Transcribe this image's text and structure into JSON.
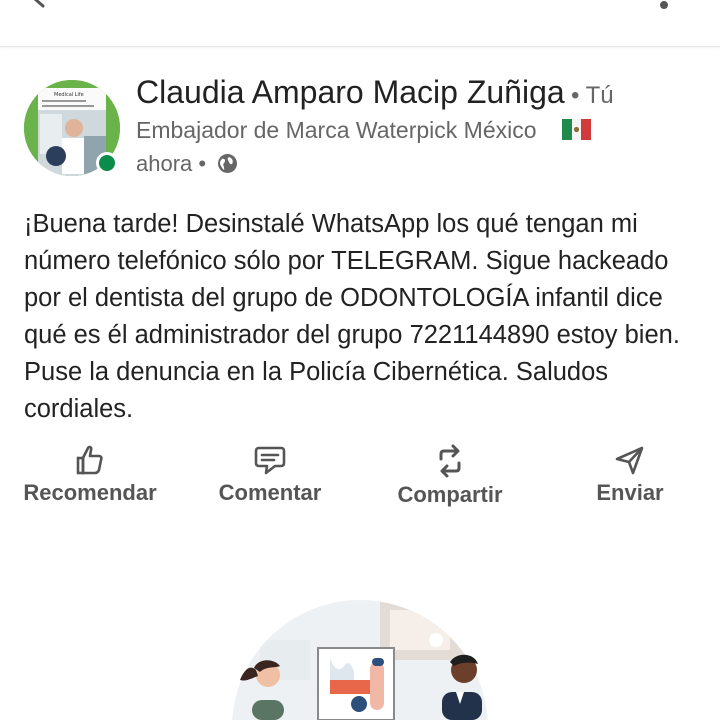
{
  "post": {
    "author": {
      "name": "Claudia Amparo Macip Zuñiga",
      "you_badge": "• Tú",
      "headline": "Embajador de Marca Waterpick México",
      "headline_flag": "mexico-flag-icon",
      "time": "ahora •",
      "visibility_icon": "globe-icon",
      "online": true,
      "avatar_text": "Medical Life"
    },
    "text": "¡Buena tarde! Desinstalé WhatsApp los qué tengan mi número telefónico sólo por TELEGRAM. Sigue hackeado por el dentista del grupo de ODONTOLOGÍA infantil dice qué es él administrador del grupo 7221144890 estoy bien. Puse la denuncia en la Policía Cibernética. Saludos cordiales."
  },
  "actions": [
    {
      "label": "Recomendar",
      "icon": "thumbs-up-icon"
    },
    {
      "label": "Comentar",
      "icon": "comment-icon"
    },
    {
      "label": "Compartir",
      "icon": "repost-icon"
    },
    {
      "label": "Enviar",
      "icon": "send-icon"
    }
  ],
  "colors": {
    "text": "#222222",
    "secondary": "#666666",
    "presence": "#0a8c4a",
    "action": "#555555"
  }
}
